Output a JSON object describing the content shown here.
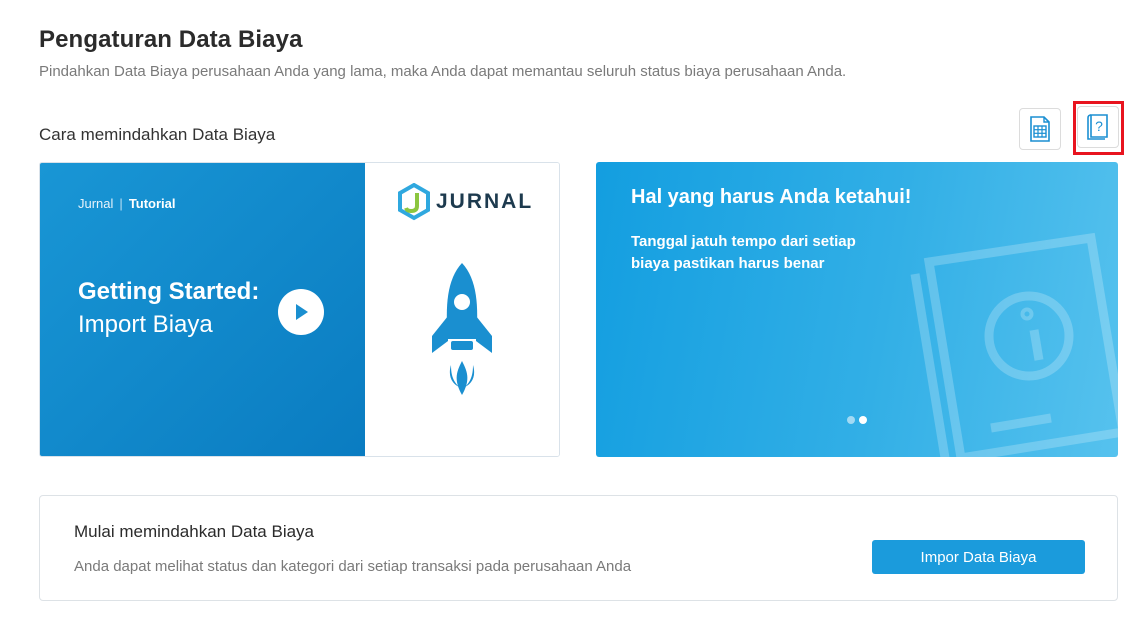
{
  "header": {
    "title": "Pengaturan Data Biaya",
    "subtitle": "Pindahkan Data Biaya perusahaan Anda yang lama, maka Anda dapat memantau seluruh status biaya perusahaan Anda."
  },
  "section": {
    "title": "Cara memindahkan Data Biaya"
  },
  "toolbar": {
    "icons": [
      "spreadsheet-icon",
      "help-book-icon"
    ]
  },
  "video_card": {
    "brand": "Jurnal",
    "brand_tag": "Tutorial",
    "heading": "Getting Started:",
    "subheading": "Import Biaya",
    "logo_text": "JURNAL",
    "colors": {
      "bg_start": "#1996d5",
      "bg_end": "#0a7cc1",
      "rocket": "#1a8fd0"
    }
  },
  "info_card": {
    "title": "Hal yang harus Anda ketahui!",
    "text": "Tanggal jatuh tempo dari setiap biaya pastikan harus benar",
    "slides": 2,
    "active_slide": 2
  },
  "import_panel": {
    "title": "Mulai memindahkan Data Biaya",
    "description": "Anda dapat melihat status dan kategori dari setiap transaksi pada perusahaan Anda",
    "button_label": "Impor Data Biaya"
  },
  "colors": {
    "accent": "#1b9bdc",
    "highlight": "#e8141f"
  }
}
